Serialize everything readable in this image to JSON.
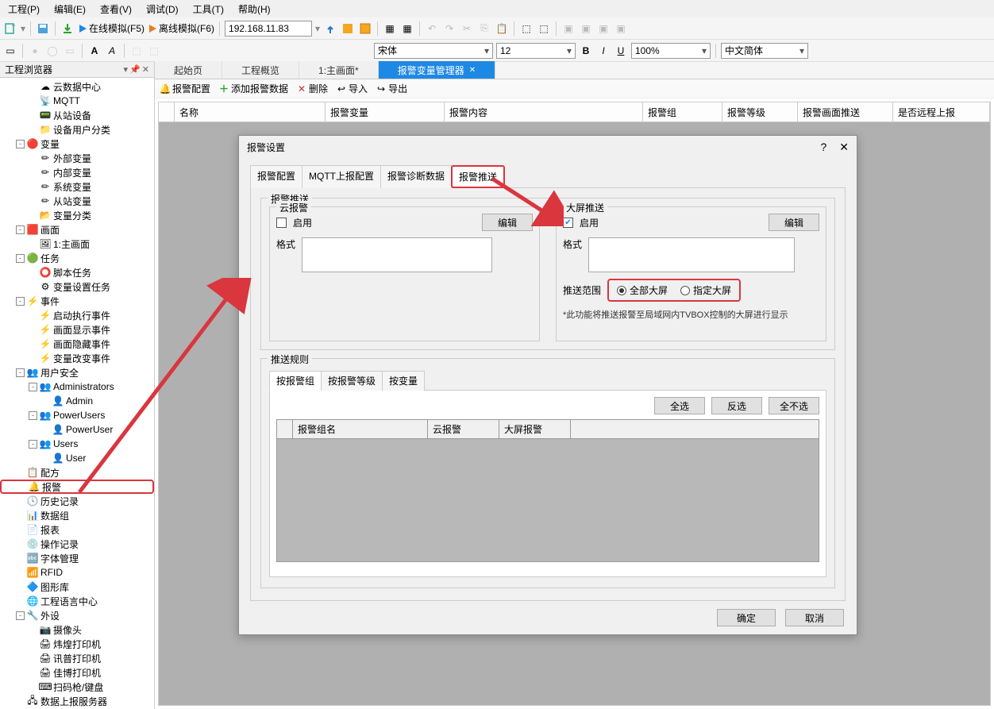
{
  "menu": {
    "items": [
      "工程(P)",
      "编辑(E)",
      "查看(V)",
      "调试(D)",
      "工具(T)",
      "帮助(H)"
    ]
  },
  "toolbar1": {
    "online_sim": "在线模拟(F5)",
    "offline_sim": "离线模拟(F6)",
    "ip": "192.168.11.83"
  },
  "toolbar2": {
    "font": "宋体",
    "size": "12",
    "zoom": "100%",
    "lang": "中文简体"
  },
  "sidebar": {
    "title": "工程浏览器",
    "items": [
      {
        "lvl": 2,
        "icon": "cloud",
        "label": "云数据中心"
      },
      {
        "lvl": 2,
        "icon": "mqtt",
        "label": "MQTT"
      },
      {
        "lvl": 2,
        "icon": "dev",
        "label": "从站设备"
      },
      {
        "lvl": 2,
        "icon": "folder",
        "label": "设备用户分类"
      },
      {
        "lvl": 1,
        "toggle": "-",
        "icon": "var-red",
        "label": "变量"
      },
      {
        "lvl": 2,
        "icon": "var-y",
        "label": "外部变量"
      },
      {
        "lvl": 2,
        "icon": "var-y",
        "label": "内部变量"
      },
      {
        "lvl": 2,
        "icon": "var-y",
        "label": "系统变量"
      },
      {
        "lvl": 2,
        "icon": "var-y",
        "label": "从站变量"
      },
      {
        "lvl": 2,
        "icon": "folder-g",
        "label": "变量分类"
      },
      {
        "lvl": 1,
        "toggle": "-",
        "icon": "screen-r",
        "label": "画面"
      },
      {
        "lvl": 2,
        "icon": "screen",
        "label": "1:主画面"
      },
      {
        "lvl": 1,
        "toggle": "-",
        "icon": "task-g",
        "label": "任务"
      },
      {
        "lvl": 2,
        "icon": "script",
        "label": "脚本任务"
      },
      {
        "lvl": 2,
        "icon": "gear",
        "label": "变量设置任务"
      },
      {
        "lvl": 1,
        "toggle": "-",
        "icon": "event-y",
        "label": "事件"
      },
      {
        "lvl": 2,
        "icon": "bolt",
        "label": "启动执行事件"
      },
      {
        "lvl": 2,
        "icon": "bolt",
        "label": "画面显示事件"
      },
      {
        "lvl": 2,
        "icon": "bolt",
        "label": "画面隐藏事件"
      },
      {
        "lvl": 2,
        "icon": "bolt",
        "label": "变量改变事件"
      },
      {
        "lvl": 1,
        "toggle": "-",
        "icon": "users",
        "label": "用户安全"
      },
      {
        "lvl": 2,
        "toggle": "-",
        "icon": "group",
        "label": "Administrators"
      },
      {
        "lvl": 3,
        "icon": "user",
        "label": "Admin"
      },
      {
        "lvl": 2,
        "toggle": "-",
        "icon": "group",
        "label": "PowerUsers"
      },
      {
        "lvl": 3,
        "icon": "user",
        "label": "PowerUser"
      },
      {
        "lvl": 2,
        "toggle": "-",
        "icon": "group",
        "label": "Users"
      },
      {
        "lvl": 3,
        "icon": "user",
        "label": "User"
      },
      {
        "lvl": 1,
        "icon": "recipe",
        "label": "配方"
      },
      {
        "lvl": 1,
        "icon": "alarm",
        "label": "报警",
        "hl": true
      },
      {
        "lvl": 1,
        "icon": "history",
        "label": "历史记录"
      },
      {
        "lvl": 1,
        "icon": "data",
        "label": "数据组"
      },
      {
        "lvl": 1,
        "icon": "report",
        "label": "报表"
      },
      {
        "lvl": 1,
        "icon": "oplog",
        "label": "操作记录"
      },
      {
        "lvl": 1,
        "icon": "font",
        "label": "字体管理"
      },
      {
        "lvl": 1,
        "icon": "rfid",
        "label": "RFID"
      },
      {
        "lvl": 1,
        "icon": "shape",
        "label": "图形库"
      },
      {
        "lvl": 1,
        "icon": "lang",
        "label": "工程语言中心"
      },
      {
        "lvl": 1,
        "toggle": "-",
        "icon": "periph",
        "label": "外设"
      },
      {
        "lvl": 2,
        "icon": "cam",
        "label": "摄像头"
      },
      {
        "lvl": 2,
        "icon": "printer",
        "label": "炜煌打印机"
      },
      {
        "lvl": 2,
        "icon": "printer",
        "label": "讯普打印机"
      },
      {
        "lvl": 2,
        "icon": "printer",
        "label": "佳博打印机"
      },
      {
        "lvl": 2,
        "icon": "scan",
        "label": "扫码枪/键盘"
      },
      {
        "lvl": 1,
        "icon": "server",
        "label": "数据上报服务器"
      }
    ]
  },
  "tabs": [
    {
      "label": "起始页",
      "active": false
    },
    {
      "label": "工程概览",
      "active": false
    },
    {
      "label": "1:主画面*",
      "active": false
    },
    {
      "label": "报警变量管理器",
      "active": true
    }
  ],
  "actions": {
    "config": "报警配置",
    "add": "添加报警数据",
    "del": "删除",
    "import": "导入",
    "export": "导出"
  },
  "grid": {
    "cols": [
      "名称",
      "报警变量",
      "报警内容",
      "报警组",
      "报警等级",
      "报警画面推送",
      "是否远程上报"
    ]
  },
  "dialog": {
    "title": "报警设置",
    "tabs": [
      "报警配置",
      "MQTT上报配置",
      "报警诊断数据",
      "报警推送"
    ],
    "active_tab": "报警推送",
    "push_fieldset": "报警推送",
    "cloud": {
      "legend": "云报警",
      "enable": "启用",
      "edit": "编辑",
      "format": "格式"
    },
    "big": {
      "legend": "大屏推送",
      "enable": "启用",
      "edit": "编辑",
      "format": "格式",
      "range_label": "推送范围",
      "all": "全部大屏",
      "spec": "指定大屏",
      "note": "*此功能将推送报警至局域网内TVBOX控制的大屏进行显示"
    },
    "rules": {
      "legend": "推送规则",
      "tabs": [
        "按报警组",
        "按报警等级",
        "按变量"
      ],
      "select_all": "全选",
      "invert": "反选",
      "none": "全不选",
      "cols": [
        "报警组名",
        "云报警",
        "大屏报警"
      ]
    },
    "ok": "确定",
    "cancel": "取消"
  }
}
